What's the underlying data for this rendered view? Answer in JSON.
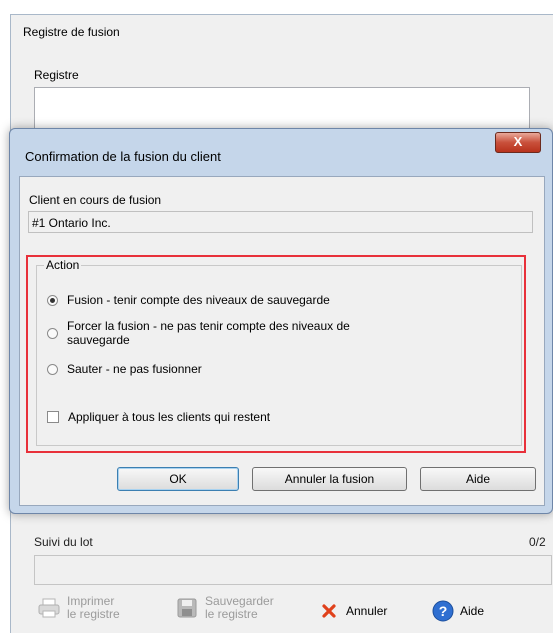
{
  "background_window": {
    "title": "Registre de fusion",
    "register_label": "Registre",
    "progress_label": "Suivi du lot",
    "progress_count": "0/2",
    "toolbar": {
      "print_line1": "Imprimer",
      "print_line2": "le registre",
      "save_line1": "Sauvegarder",
      "save_line2": "le registre",
      "cancel_label": "Annuler",
      "help_label": "Aide"
    }
  },
  "dialog": {
    "title": "Confirmation de la fusion du client",
    "close_label": "X",
    "client_label": "Client en cours de fusion",
    "client_value": "#1  Ontario Inc.",
    "action_group_label": "Action",
    "options": [
      {
        "label": "Fusion - tenir compte des niveaux de sauvegarde",
        "selected": true
      },
      {
        "label": "Forcer la fusion - ne pas tenir compte des niveaux de sauvegarde",
        "selected": false
      },
      {
        "label": "Sauter - ne pas fusionner",
        "selected": false
      }
    ],
    "apply_all_label": "Appliquer à tous les clients qui restent",
    "buttons": {
      "ok": "OK",
      "cancel_merge": "Annuler la fusion",
      "help": "Aide"
    }
  },
  "colors": {
    "highlight_border": "#e8303a",
    "dialog_frame": "#c5d6ea",
    "close_button": "#c9503b",
    "cancel_icon": "#e0411b",
    "help_icon": "#2f6fd1"
  }
}
